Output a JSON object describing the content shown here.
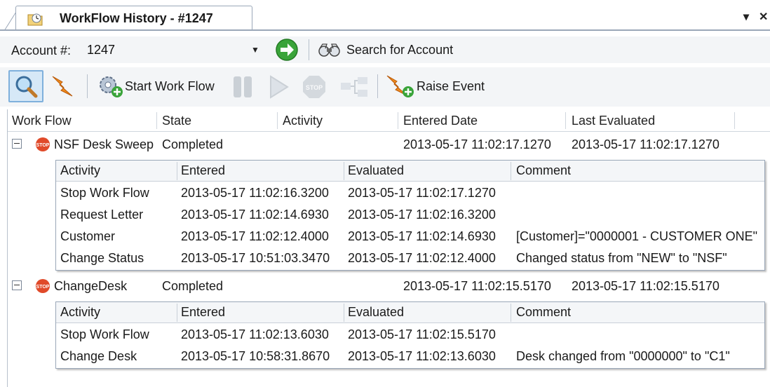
{
  "tab": {
    "title": "WorkFlow History - #1247",
    "icon": "workflow-history-icon",
    "dropdown_glyph": "▾",
    "close_glyph": "✕"
  },
  "account": {
    "label": "Account #:",
    "value": "1247",
    "search_label": "Search for Account"
  },
  "toolbar": {
    "start_workflow_label": "Start Work Flow",
    "raise_event_label": "Raise Event"
  },
  "grid": {
    "columns": [
      "Work Flow",
      "State",
      "Activity",
      "Entered Date",
      "Last Evaluated"
    ],
    "detail_columns": [
      "Activity",
      "Entered",
      "Evaluated",
      "Comment"
    ],
    "workflows": [
      {
        "name": "NSF Desk Sweep",
        "state": "Completed",
        "activity": "",
        "entered_date": "2013-05-17 11:02:17.1270",
        "last_evaluated": "2013-05-17 11:02:17.1270",
        "activities": [
          {
            "activity": "Stop Work Flow",
            "entered": "2013-05-17 11:02:16.3200",
            "evaluated": "2013-05-17 11:02:17.1270",
            "comment": ""
          },
          {
            "activity": "Request Letter",
            "entered": "2013-05-17 11:02:14.6930",
            "evaluated": "2013-05-17 11:02:16.3200",
            "comment": ""
          },
          {
            "activity": "Customer",
            "entered": "2013-05-17 11:02:12.4000",
            "evaluated": "2013-05-17 11:02:14.6930",
            "comment": "[Customer]=\"0000001 - CUSTOMER ONE\""
          },
          {
            "activity": "Change Status",
            "entered": "2013-05-17 10:51:03.3470",
            "evaluated": "2013-05-17 11:02:12.4000",
            "comment": "Changed status from \"NEW\" to \"NSF\""
          }
        ]
      },
      {
        "name": "ChangeDesk",
        "state": "Completed",
        "activity": "",
        "entered_date": "2013-05-17 11:02:15.5170",
        "last_evaluated": "2013-05-17 11:02:15.5170",
        "activities": [
          {
            "activity": "Stop Work Flow",
            "entered": "2013-05-17 11:02:13.6030",
            "evaluated": "2013-05-17 11:02:15.5170",
            "comment": ""
          },
          {
            "activity": "Change Desk",
            "entered": "2013-05-17 10:58:31.8670",
            "evaluated": "2013-05-17 11:02:13.6030",
            "comment": "Desk changed from \"0000000\" to \"C1\""
          }
        ]
      }
    ]
  },
  "colors": {
    "accent_green": "#3aa43a",
    "stop_red": "#e04a2a",
    "border": "#9aa7b8",
    "toolbar_bg": "#f3f5f7"
  }
}
